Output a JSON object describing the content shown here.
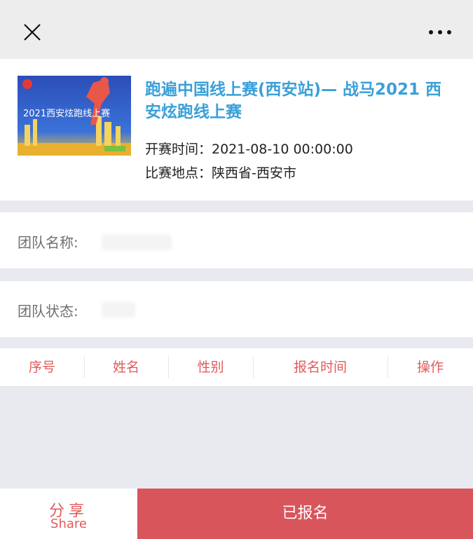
{
  "event": {
    "title": "跑遍中国线上赛(西安站)— 战马2021 西安炫跑线上赛",
    "start_time": "开赛时间：2021-08-10 00:00:00",
    "location": "比赛地点：陕西省-西安市",
    "poster_text": "2021西安炫跑线上赛",
    "title_color": "#3aa0d8"
  },
  "team": {
    "name_label": "团队名称:",
    "status_label": "团队状态:"
  },
  "table": {
    "headers": [
      "序号",
      "姓名",
      "性别",
      "报名时间",
      "操作"
    ]
  },
  "footer": {
    "share_cn": "分享",
    "share_en": "Share",
    "registered_label": "已报名",
    "accent_color": "#d8555c"
  },
  "icons": {
    "close": "close-icon",
    "more": "more-icon"
  }
}
